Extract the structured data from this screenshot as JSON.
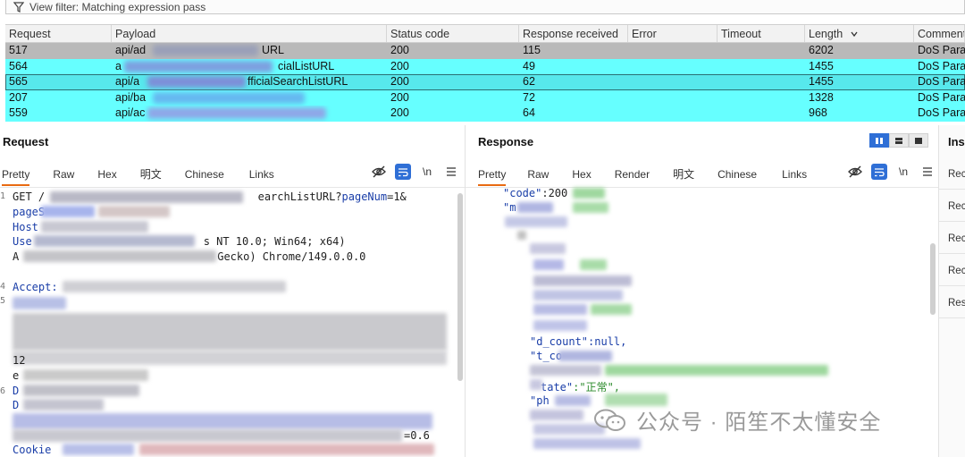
{
  "filter": {
    "label": "View filter: Matching expression pass"
  },
  "table": {
    "columns": [
      "Request",
      "Payload",
      "Status code",
      "Response received",
      "Error",
      "Timeout",
      "Length",
      "Comment"
    ],
    "rows": [
      {
        "request": "517",
        "payload": "api/ad",
        "payload_tail": "URL",
        "status": "200",
        "received": "115",
        "error": "",
        "timeout": "",
        "length": "6202",
        "comment": "DoS Param"
      },
      {
        "request": "564",
        "payload": "a",
        "payload_tail": "cialListURL",
        "status": "200",
        "received": "49",
        "error": "",
        "timeout": "",
        "length": "1455",
        "comment": "DoS Param"
      },
      {
        "request": "565",
        "payload": "api/a",
        "payload_tail": "fficialSearchListURL",
        "status": "200",
        "received": "62",
        "error": "",
        "timeout": "",
        "length": "1455",
        "comment": "DoS Param"
      },
      {
        "request": "207",
        "payload": "api/ba",
        "payload_tail": "",
        "status": "200",
        "received": "72",
        "error": "",
        "timeout": "",
        "length": "1328",
        "comment": "DoS Param"
      },
      {
        "request": "559",
        "payload": "api/ac",
        "payload_tail": "",
        "status": "200",
        "received": "64",
        "error": "",
        "timeout": "",
        "length": "968",
        "comment": "DoS Param"
      }
    ]
  },
  "request": {
    "title": "Request",
    "tabs": [
      "Pretty",
      "Raw",
      "Hex",
      "明文",
      "Chinese",
      "Links"
    ],
    "tool_newline": "\\n",
    "lines": {
      "l1a": "GET /",
      "l1b": "earchListURL?",
      "l1k": "pageNum",
      "l1v": "=1&",
      "l2": "pageS",
      "l3": "Host",
      "l4a": "Use",
      "l4b": "s NT 10.0; Win64; x64)",
      "l5a": "A",
      "l5b": "Gecko) Chrome/149.0.0.0",
      "l6": "Accept:",
      "l7": "12",
      "l8": "e",
      "l9": "D",
      "l10": "D",
      "l11": "=0.6",
      "l12": "Cookie"
    },
    "gutter": [
      "1",
      "",
      "",
      "",
      "",
      "",
      "4",
      "5",
      "",
      "",
      "",
      "",
      "",
      "",
      "6",
      "",
      "",
      ""
    ]
  },
  "response": {
    "title": "Response",
    "tabs": [
      "Pretty",
      "Raw",
      "Hex",
      "Render",
      "明文",
      "Chinese",
      "Links"
    ],
    "tool_newline": "\\n",
    "lines": {
      "code_key": "\"code\"",
      "code_val": ":200",
      "m_key": "\"m",
      "d_count": "\"d_count\":null,",
      "t_co": "\"t_co",
      "tate_key": "tate\"",
      "tate_val": ":\"正常\",",
      "ph": "\"ph"
    }
  },
  "inspector": {
    "title": "Ins",
    "items": [
      "Rec",
      "Rec",
      "Rec",
      "Rec",
      "Res"
    ]
  },
  "watermark": {
    "text": "公众号 · 陌笙不太懂安全"
  },
  "colors": {
    "row_gray": "#b9b9b9",
    "row_cyan": "#66ffff",
    "accent_tab": "#e86a12",
    "button_blue": "#2f6fd6"
  }
}
